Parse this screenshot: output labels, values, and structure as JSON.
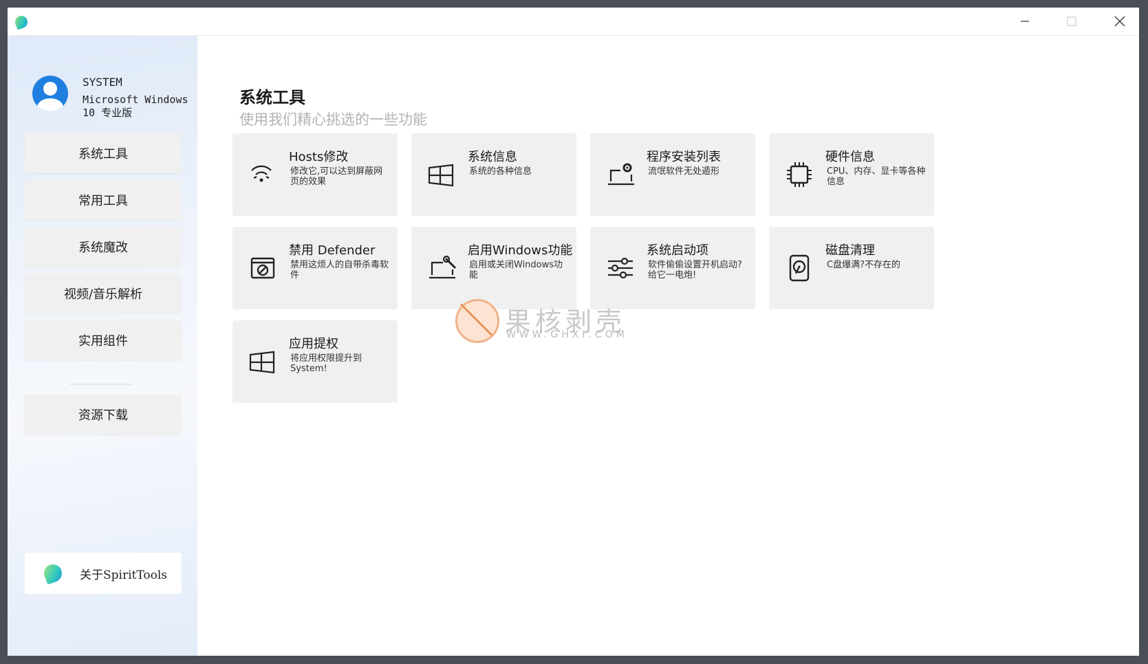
{
  "window": {
    "min_icon": "minimize-icon",
    "max_icon": "maximize-icon",
    "close_icon": "close-icon"
  },
  "user": {
    "name": "SYSTEM",
    "os": "Microsoft Windows 10 专业版"
  },
  "sidebar": {
    "items": [
      {
        "label": "系统工具"
      },
      {
        "label": "常用工具"
      },
      {
        "label": "系统魔改"
      },
      {
        "label": "视频/音乐解析"
      },
      {
        "label": "实用组件"
      },
      {
        "label": "资源下载"
      }
    ],
    "about": "关于SpiritTools"
  },
  "main": {
    "title": "系统工具",
    "subtitle": "使用我们精心挑选的一些功能",
    "cards": [
      {
        "title": "Hosts修改",
        "desc": "修改它,可以达到屏蔽网页的效果",
        "icon": "wifi-icon"
      },
      {
        "title": "系统信息",
        "desc": "系统的各种信息",
        "icon": "windows-icon"
      },
      {
        "title": "程序安装列表",
        "desc": "流氓软件无处遁形",
        "icon": "laptop-gear-icon"
      },
      {
        "title": "硬件信息",
        "desc": "CPU、内存、显卡等各种信息",
        "icon": "chip-icon"
      },
      {
        "title": "禁用 Defender",
        "desc": "禁用这烦人的自带杀毒软件",
        "icon": "blocked-window-icon"
      },
      {
        "title": "启用Windows功能",
        "desc": "启用或关闭Windows功能",
        "icon": "laptop-wrench-icon"
      },
      {
        "title": "系统启动项",
        "desc": "软件偷偷设置开机启动? 给它一电炮!",
        "icon": "sliders-icon"
      },
      {
        "title": "磁盘清理",
        "desc": "C盘爆满?不存在的",
        "icon": "hard-disk-icon"
      },
      {
        "title": "应用提权",
        "desc": "将应用权限提升到System!",
        "icon": "windows-icon"
      }
    ]
  },
  "watermark": {
    "text": "果核剥壳",
    "url": "WWW.GHXI.COM"
  }
}
